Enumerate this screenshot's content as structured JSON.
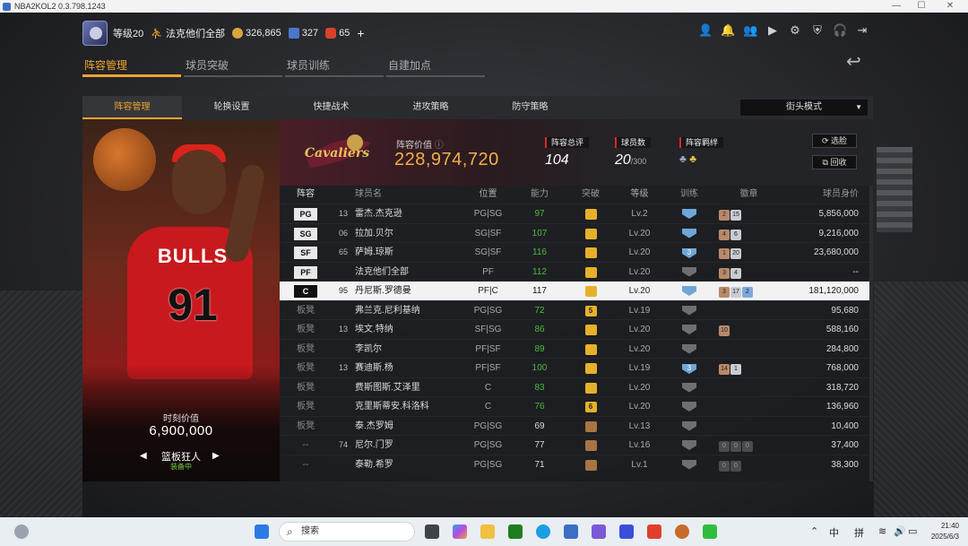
{
  "window": {
    "title": "NBA2KOL2 0.3.798.1243"
  },
  "topbar": {
    "level": "等级20",
    "player_name": "法克他们全部",
    "gold": "326,865",
    "points": "327",
    "tickets": "65",
    "add": "+"
  },
  "main_tabs": [
    "阵容管理",
    "球员突破",
    "球员训练",
    "自建加点"
  ],
  "sub_tabs": [
    "阵容管理",
    "轮换设置",
    "快捷战术",
    "进攻策略",
    "防守策略"
  ],
  "mode_select": "街头模式",
  "card": {
    "jersey_text": "BULLS",
    "jersey_number": "91",
    "value_label": "时刻价值",
    "value": "6,900,000",
    "trait": "篮板狂人",
    "status": "装备中"
  },
  "team": {
    "value_label": "阵容价值",
    "value": "228,974,720",
    "ovr_label": "阵容总评",
    "ovr": "104",
    "count_label": "球员数",
    "count": "20",
    "count_max": "/300",
    "bond_label": "阵容羁绊",
    "btn_select": "选脸",
    "btn_recycle": "回收"
  },
  "table": {
    "headers": [
      "阵容",
      "球员名",
      "位置",
      "能力",
      "突破",
      "等级",
      "训练",
      "徽章",
      "球员身价"
    ],
    "rows": [
      {
        "pos": "PG",
        "num": "13",
        "name": "雷杰.杰克逊",
        "place": "PG|SG",
        "ovr": "97",
        "lvl": "Lv.2",
        "value": "5,856,000"
      },
      {
        "pos": "SG",
        "num": "06",
        "name": "拉加.贝尔",
        "place": "SG|SF",
        "ovr": "107",
        "lvl": "Lv.20",
        "value": "9,216,000"
      },
      {
        "pos": "SF",
        "num": "65",
        "name": "萨姆.琼斯",
        "place": "SG|SF",
        "ovr": "116",
        "lvl": "Lv.20",
        "value": "23,680,000"
      },
      {
        "pos": "PF",
        "num": "",
        "name": "法克他们全部",
        "place": "PF",
        "ovr": "112",
        "lvl": "Lv.20",
        "value": "--"
      },
      {
        "pos": "C",
        "num": "95",
        "name": "丹尼斯.罗德曼",
        "place": "PF|C",
        "ovr": "117",
        "lvl": "Lv.20",
        "value": "181,120,000"
      },
      {
        "pos": "板凳",
        "num": "",
        "name": "弗兰克.尼利基纳",
        "place": "PG|SG",
        "ovr": "72",
        "lvl": "Lv.19",
        "value": "95,680"
      },
      {
        "pos": "板凳",
        "num": "13",
        "name": "埃文.特纳",
        "place": "SF|SG",
        "ovr": "86",
        "lvl": "Lv.20",
        "value": "588,160"
      },
      {
        "pos": "板凳",
        "num": "",
        "name": "李凯尔",
        "place": "PF|SF",
        "ovr": "89",
        "lvl": "Lv.20",
        "value": "284,800"
      },
      {
        "pos": "板凳",
        "num": "13",
        "name": "赛迪斯.杨",
        "place": "PF|SF",
        "ovr": "100",
        "lvl": "Lv.19",
        "value": "768,000"
      },
      {
        "pos": "板凳",
        "num": "",
        "name": "费斯图斯.艾泽里",
        "place": "C",
        "ovr": "83",
        "lvl": "Lv.20",
        "value": "318,720"
      },
      {
        "pos": "板凳",
        "num": "",
        "name": "克里斯蒂安.科洛科",
        "place": "C",
        "ovr": "76",
        "lvl": "Lv.20",
        "value": "136,960"
      },
      {
        "pos": "板凳",
        "num": "",
        "name": "泰.杰罗姆",
        "place": "PG|SG",
        "ovr": "69",
        "lvl": "Lv.13",
        "value": "10,400"
      },
      {
        "pos": "--",
        "num": "74",
        "name": "尼尔.门罗",
        "place": "PG|SG",
        "ovr": "77",
        "lvl": "Lv.16",
        "value": "37,400"
      },
      {
        "pos": "--",
        "num": "",
        "name": "泰勒.希罗",
        "place": "PG|SG",
        "ovr": "71",
        "lvl": "Lv.1",
        "value": "38,300"
      }
    ]
  },
  "taskbar": {
    "search": "搜索",
    "ime1": "中",
    "ime2": "拼",
    "time": "21:40",
    "date": "2025/6/3"
  }
}
